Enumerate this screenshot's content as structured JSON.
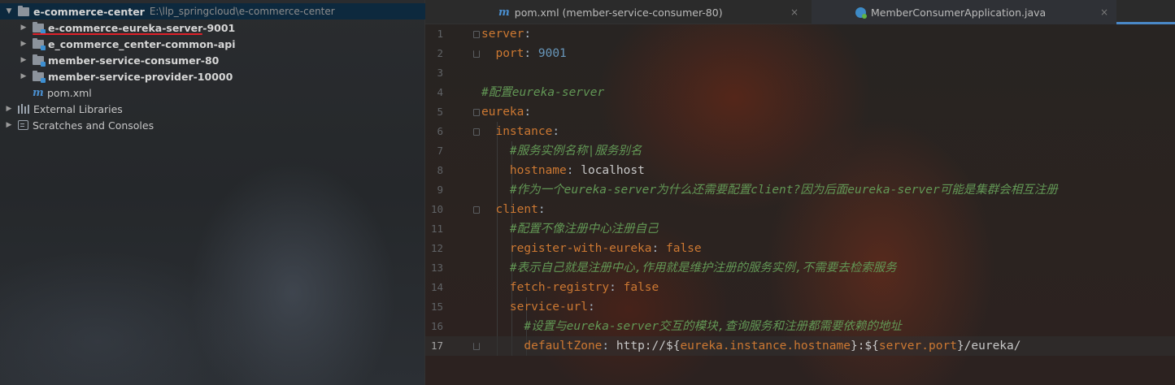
{
  "project_tree": {
    "root": {
      "name": "e-commerce-center",
      "path": "E:\\llp_springcloud\\e-commerce-center"
    },
    "modules": [
      {
        "name": "e-commerce-eureka-server-9001"
      },
      {
        "name": "e_commerce_center-common-api"
      },
      {
        "name": "member-service-consumer-80"
      },
      {
        "name": "member-service-provider-10000"
      }
    ],
    "pom": "pom.xml",
    "external_libraries": "External Libraries",
    "scratches": "Scratches and Consoles",
    "icons": [
      "folder-icon",
      "module-folder-icon",
      "maven-icon",
      "library-icon",
      "scratch-icon",
      "expand-arrow-icon"
    ]
  },
  "tabs": [
    {
      "label": "pom.xml (member-service-consumer-80)",
      "icon": "maven-icon",
      "close": "×"
    },
    {
      "label": "MemberConsumerApplication.java",
      "icon": "spring-class-icon",
      "close": "×"
    }
  ],
  "editor": {
    "current_line": 17,
    "lines": [
      {
        "num": "1",
        "tokens": [
          {
            "t": "server",
            "c": "k"
          },
          {
            "t": ":",
            "c": "p"
          }
        ]
      },
      {
        "num": "2",
        "tokens": [
          {
            "t": "  port",
            "c": "k"
          },
          {
            "t": ": ",
            "c": "p"
          },
          {
            "t": "9001",
            "c": "n"
          }
        ]
      },
      {
        "num": "3",
        "tokens": []
      },
      {
        "num": "4",
        "tokens": [
          {
            "t": "#配置eureka-server",
            "c": "c"
          }
        ]
      },
      {
        "num": "5",
        "tokens": [
          {
            "t": "eureka",
            "c": "k"
          },
          {
            "t": ":",
            "c": "p"
          }
        ]
      },
      {
        "num": "6",
        "tokens": [
          {
            "t": "  instance",
            "c": "k"
          },
          {
            "t": ":",
            "c": "p"
          }
        ]
      },
      {
        "num": "7",
        "tokens": [
          {
            "t": "    #服务实例名称|服务别名",
            "c": "c"
          }
        ]
      },
      {
        "num": "8",
        "tokens": [
          {
            "t": "    hostname",
            "c": "k"
          },
          {
            "t": ": ",
            "c": "p"
          },
          {
            "t": "localhost",
            "c": "v"
          }
        ]
      },
      {
        "num": "9",
        "tokens": [
          {
            "t": "    #作为一个eureka-server为什么还需要配置client?因为后面eureka-server可能是集群会相互注册",
            "c": "c"
          }
        ]
      },
      {
        "num": "10",
        "tokens": [
          {
            "t": "  client",
            "c": "k"
          },
          {
            "t": ":",
            "c": "p"
          }
        ]
      },
      {
        "num": "11",
        "tokens": [
          {
            "t": "    #配置不像注册中心注册自己",
            "c": "c"
          }
        ]
      },
      {
        "num": "12",
        "tokens": [
          {
            "t": "    register-with-eureka",
            "c": "k"
          },
          {
            "t": ": ",
            "c": "p"
          },
          {
            "t": "false",
            "c": "b"
          }
        ]
      },
      {
        "num": "13",
        "tokens": [
          {
            "t": "    #表示自己就是注册中心,作用就是维护注册的服务实例,不需要去检索服务",
            "c": "c"
          }
        ]
      },
      {
        "num": "14",
        "tokens": [
          {
            "t": "    fetch-registry",
            "c": "k"
          },
          {
            "t": ": ",
            "c": "p"
          },
          {
            "t": "false",
            "c": "b"
          }
        ]
      },
      {
        "num": "15",
        "tokens": [
          {
            "t": "    service-url",
            "c": "k"
          },
          {
            "t": ":",
            "c": "p"
          }
        ]
      },
      {
        "num": "16",
        "tokens": [
          {
            "t": "      #设置与eureka-server交互的模块,查询服务和注册都需要依赖的地址",
            "c": "c"
          }
        ]
      },
      {
        "num": "17",
        "tokens": [
          {
            "t": "      defaultZone",
            "c": "k"
          },
          {
            "t": ": ",
            "c": "p"
          },
          {
            "t": "http://${",
            "c": "v"
          },
          {
            "t": "eureka.instance.hostname",
            "c": "k"
          },
          {
            "t": "}:${",
            "c": "v"
          },
          {
            "t": "server.port",
            "c": "k"
          },
          {
            "t": "}/eureka/",
            "c": "v"
          }
        ]
      }
    ]
  }
}
